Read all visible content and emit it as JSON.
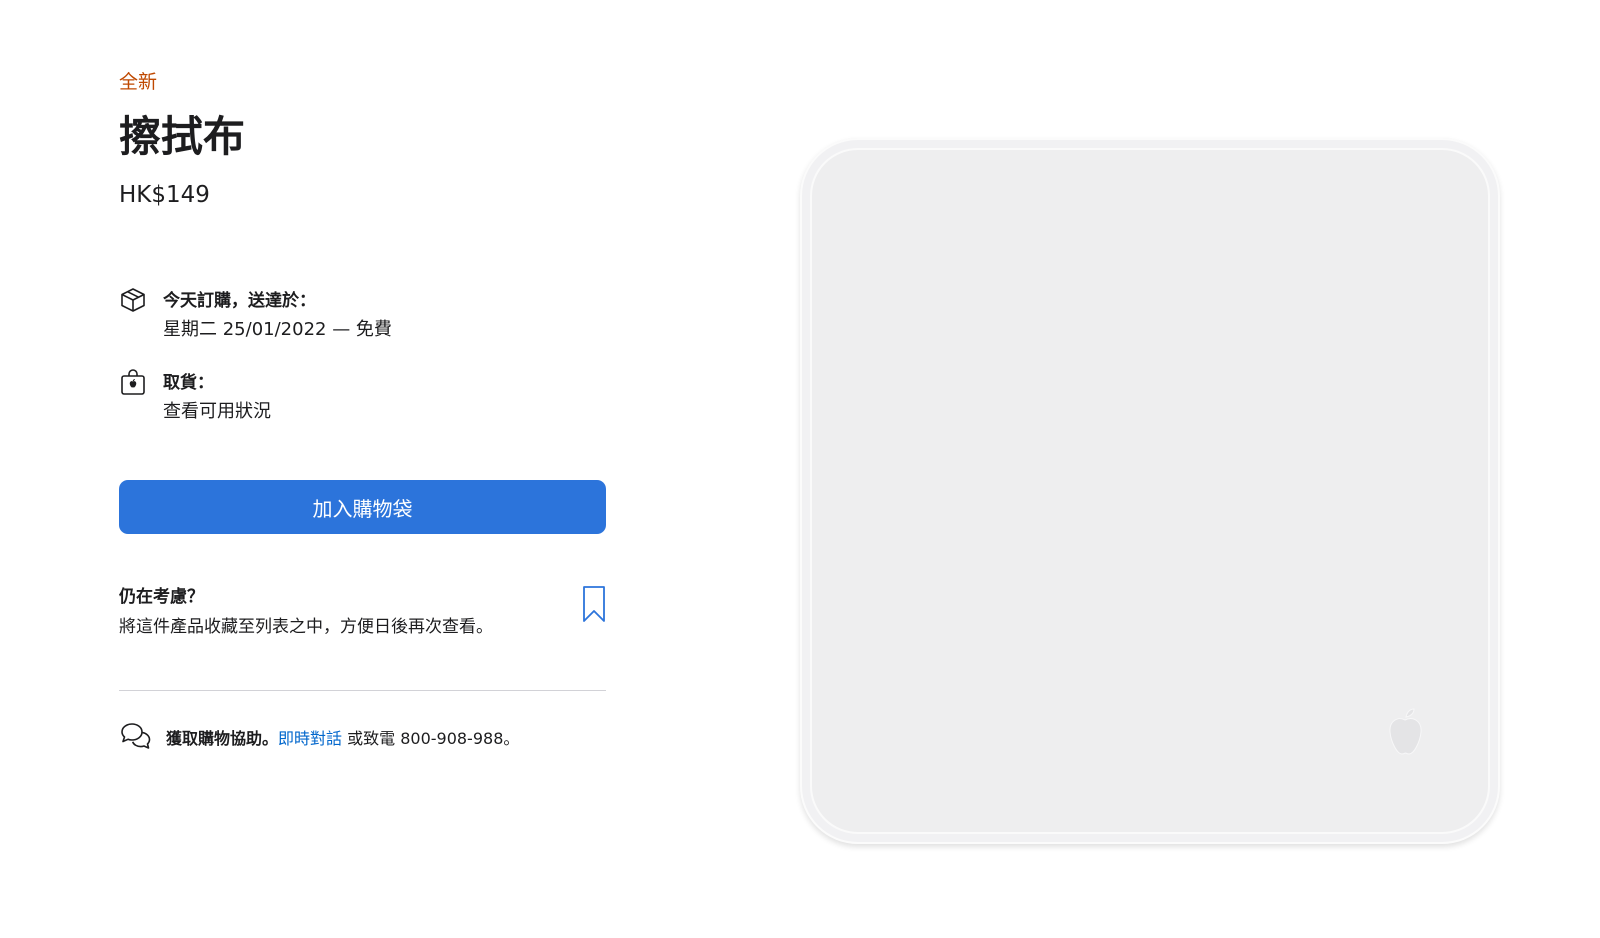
{
  "product": {
    "badge": "全新",
    "title": "擦拭布",
    "price": "HK$149"
  },
  "delivery": {
    "icon": "box-icon",
    "label": "今天訂購，送達於：",
    "value": "星期二 25/01/2022 — 免費"
  },
  "pickup": {
    "icon": "store-bag-icon",
    "label": "取貨：",
    "link": "查看可用狀況"
  },
  "add_to_bag": {
    "label": "加入購物袋",
    "color": "#2c74db"
  },
  "save_for_later": {
    "title": "仍在考慮？",
    "description": "將這件產品收藏至列表之中，方便日後再次查看。",
    "icon": "bookmark-icon"
  },
  "help": {
    "icon": "chat-bubbles-icon",
    "strong": "獲取購物協助。",
    "link": "即時對話",
    "rest": " 或致電 800-908-988。"
  },
  "colors": {
    "badge": "#bf4800",
    "link": "#0066cc",
    "text": "#1d1d1f"
  }
}
